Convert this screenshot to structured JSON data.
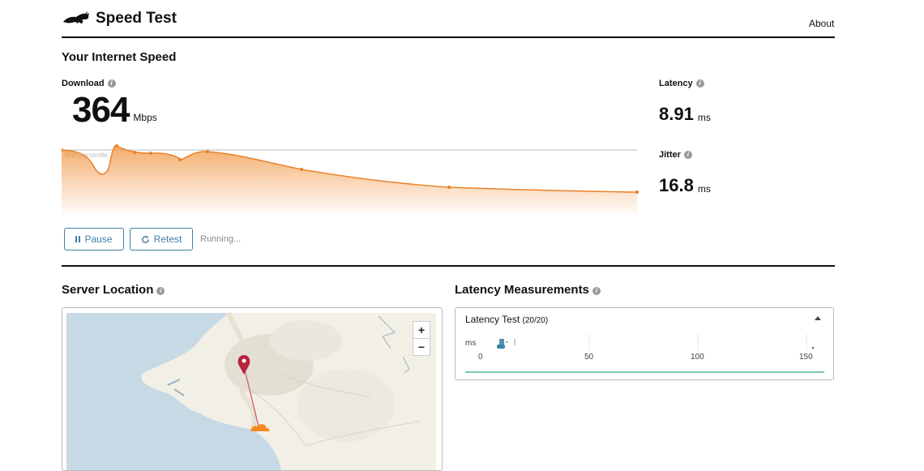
{
  "header": {
    "title": "Speed Test",
    "about": "About"
  },
  "speed": {
    "section_title": "Your Internet Speed",
    "download_label": "Download",
    "download_value": "364",
    "download_unit": "Mbps",
    "percentile_label": "90th percentile",
    "latency_label": "Latency",
    "latency_value": "8.91",
    "latency_unit": "ms",
    "jitter_label": "Jitter",
    "jitter_value": "16.8",
    "jitter_unit": "ms",
    "accent": "#f0913a"
  },
  "controls": {
    "pause_label": "Pause",
    "retest_label": "Retest",
    "status": "Running..."
  },
  "server_location": {
    "title": "Server Location",
    "zoom_in": "+",
    "zoom_out": "−"
  },
  "latency_measurements": {
    "title": "Latency Measurements",
    "panel_title": "Latency Test",
    "panel_count": "(20/20)",
    "unit": "ms",
    "ticks": [
      "0",
      "50",
      "100",
      "150"
    ],
    "line_color": "#7cc7b4"
  }
}
